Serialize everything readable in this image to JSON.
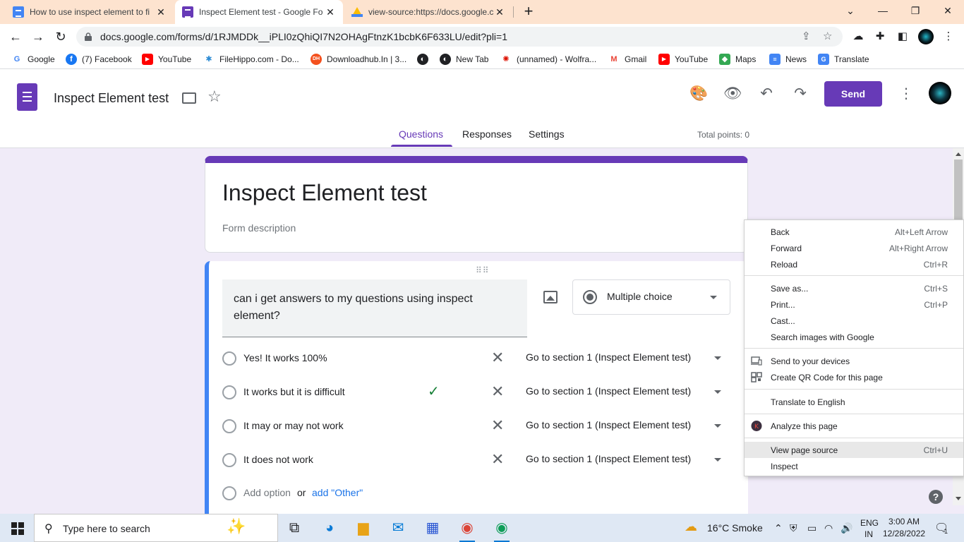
{
  "browser": {
    "tabs": [
      {
        "title": "How to use inspect element to fi",
        "icon": "google-docs-icon"
      },
      {
        "title": "Inspect Element test - Google Fo",
        "icon": "google-forms-icon"
      },
      {
        "title": "view-source:https://docs.google.c",
        "icon": "google-drive-icon"
      }
    ],
    "url": "docs.google.com/forms/d/1RJMDDk__iPLI0zQhiQI7N2OHAgFtnzK1bcbK6F633LU/edit?pli=1",
    "bookmarks": [
      {
        "label": "Google"
      },
      {
        "label": "(7) Facebook"
      },
      {
        "label": "YouTube"
      },
      {
        "label": "FileHippo.com - Do..."
      },
      {
        "label": "Downloadhub.In | 3..."
      },
      {
        "label": ""
      },
      {
        "label": "New Tab"
      },
      {
        "label": "(unnamed) - Wolfra..."
      },
      {
        "label": "Gmail"
      },
      {
        "label": "YouTube"
      },
      {
        "label": "Maps"
      },
      {
        "label": "News"
      },
      {
        "label": "Translate"
      }
    ]
  },
  "forms": {
    "doc_title": "Inspect Element test",
    "send_label": "Send",
    "tabs": {
      "questions": "Questions",
      "responses": "Responses",
      "settings": "Settings"
    },
    "total_points": "Total points: 0",
    "form_title": "Inspect Element test",
    "form_description": "Form description",
    "question": {
      "text": "can i get answers to my questions using inspect element?",
      "type": "Multiple choice",
      "options": [
        {
          "label": "Yes! It works 100%",
          "goto": "Go to section 1 (Inspect Element test)",
          "correct": false
        },
        {
          "label": "It works but it is difficult",
          "goto": "Go to section 1 (Inspect Element test)",
          "correct": true
        },
        {
          "label": "It may or may not work",
          "goto": "Go to section 1 (Inspect Element test)",
          "correct": false
        },
        {
          "label": "It does not work",
          "goto": "Go to section 1 (Inspect Element test)",
          "correct": false
        }
      ],
      "add_option": "Add option",
      "or": "or",
      "add_other": "add \"Other\""
    }
  },
  "context_menu": {
    "items": [
      {
        "label": "Back",
        "shortcut": "Alt+Left Arrow"
      },
      {
        "label": "Forward",
        "shortcut": "Alt+Right Arrow"
      },
      {
        "label": "Reload",
        "shortcut": "Ctrl+R"
      },
      {
        "label": "Save as...",
        "shortcut": "Ctrl+S"
      },
      {
        "label": "Print...",
        "shortcut": "Ctrl+P"
      },
      {
        "label": "Cast...",
        "shortcut": ""
      },
      {
        "label": "Search images with Google",
        "shortcut": ""
      },
      {
        "label": "Send to your devices",
        "shortcut": ""
      },
      {
        "label": "Create QR Code for this page",
        "shortcut": ""
      },
      {
        "label": "Translate to English",
        "shortcut": ""
      },
      {
        "label": "Analyze this page",
        "shortcut": ""
      },
      {
        "label": "View page source",
        "shortcut": "Ctrl+U"
      },
      {
        "label": "Inspect",
        "shortcut": ""
      }
    ]
  },
  "taskbar": {
    "search_placeholder": "Type here to search",
    "weather": "16°C  Smoke",
    "lang_top": "ENG",
    "lang_bottom": "IN",
    "time": "3:00 AM",
    "date": "12/28/2022",
    "notifications": "1"
  },
  "colors": {
    "forms_purple": "#673ab7",
    "question_accent": "#4285f4",
    "correct_green": "#188038",
    "page_bg": "#f0ebf8",
    "tabbar_bg": "#fde3cf"
  }
}
